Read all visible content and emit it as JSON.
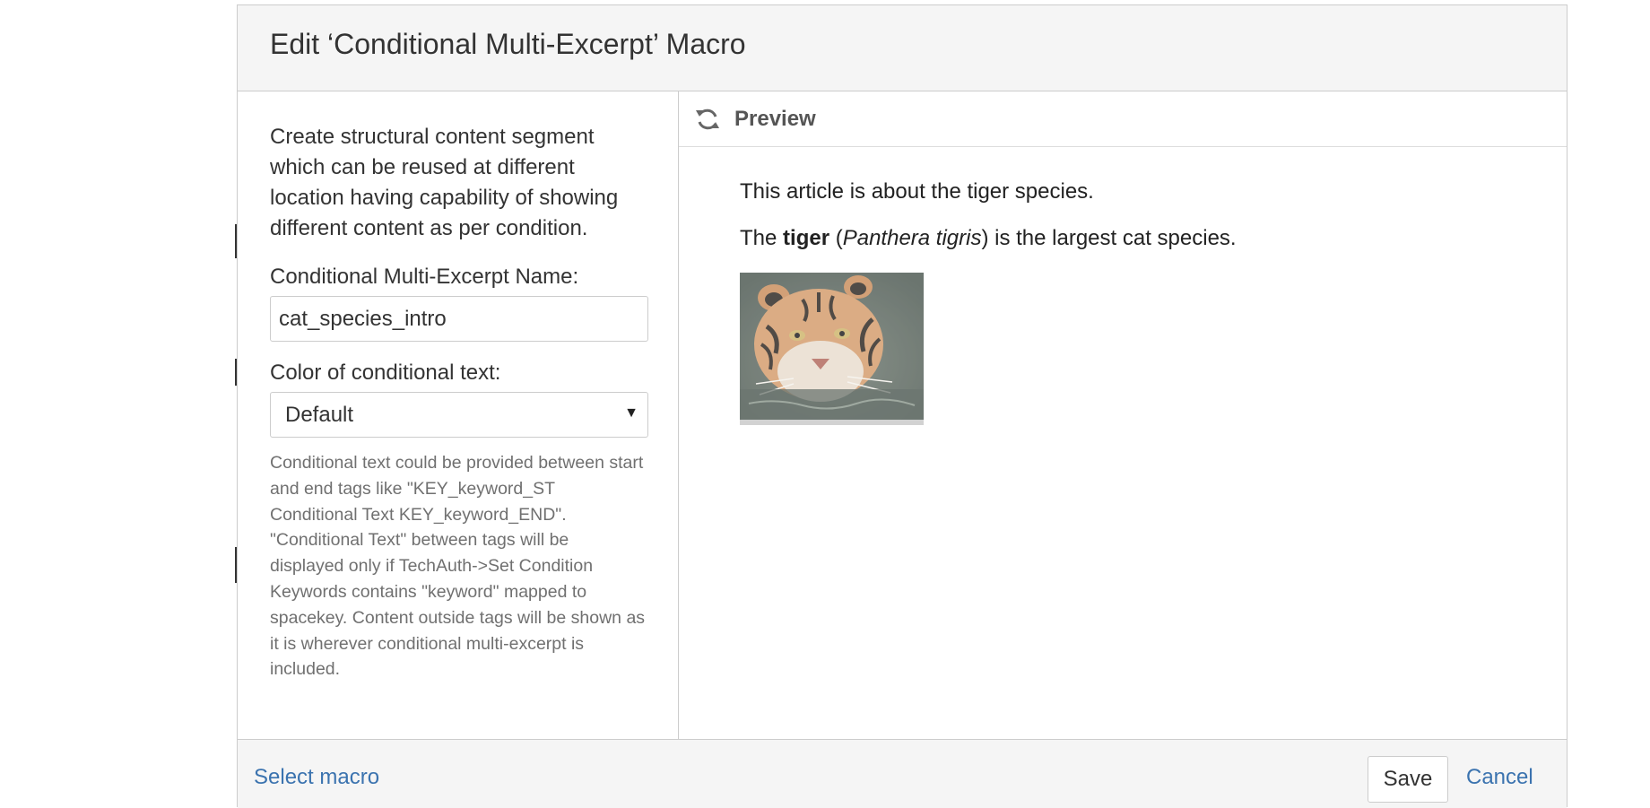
{
  "dialog": {
    "title": "Edit ‘Conditional Multi-Excerpt’ Macro"
  },
  "form": {
    "description": "Create structural content segment which can be reused at different location having capability of showing different content as per condition.",
    "name_label": "Conditional Multi-Excerpt Name:",
    "name_value": "cat_species_intro",
    "color_label": "Color of conditional text:",
    "color_selected": "Default",
    "help_text": "Conditional text could be provided between start and end tags like \"KEY_keyword_ST Conditional Text KEY_keyword_END\". \"Conditional Text\" between tags will be displayed only if TechAuth->Set Condition Keywords contains \"keyword\" mapped to spacekey. Content outside tags will be shown as it is wherever conditional multi-excerpt is included."
  },
  "preview": {
    "header_label": "Preview",
    "header_icon": "refresh-icon",
    "line1": "This article is about the tiger species.",
    "line2_prefix": "The ",
    "line2_bold": "tiger",
    "line2_open": " (",
    "line2_italic": "Panthera tigris",
    "line2_suffix": ") is the largest cat species.",
    "image_subject": "tiger swimming in water"
  },
  "footer": {
    "select_macro": "Select macro",
    "save": "Save",
    "cancel": "Cancel"
  },
  "colors": {
    "link": "#3b73af",
    "header_bg": "#f5f5f5",
    "border": "#cccccc"
  }
}
